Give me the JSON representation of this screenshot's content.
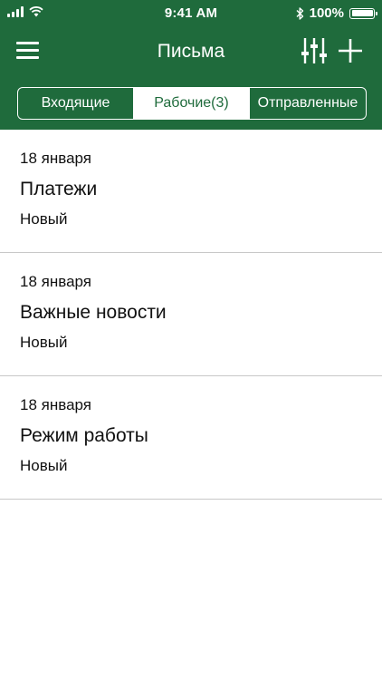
{
  "status_bar": {
    "time": "9:41 AM",
    "battery": "100%",
    "icons": [
      "signal-icon",
      "wifi-icon",
      "bluetooth-icon",
      "battery-icon"
    ]
  },
  "header": {
    "title": "Письма",
    "icons": {
      "menu": "hamburger-menu-icon",
      "filter": "sliders-icon",
      "add": "plus-icon"
    }
  },
  "tabs": [
    {
      "label": "Входящие",
      "active": false
    },
    {
      "label": "Рабочие(3)",
      "active": true
    },
    {
      "label": "Отправленные",
      "active": false
    }
  ],
  "messages": [
    {
      "date": "18 января",
      "title": "Платежи",
      "status": "Новый"
    },
    {
      "date": "18 января",
      "title": "Важные новости",
      "status": "Новый"
    },
    {
      "date": "18 января",
      "title": "Режим работы",
      "status": "Новый"
    }
  ],
  "colors": {
    "header_bg": "#1f6b3c",
    "header_text": "#ffffff",
    "divider": "#c8c8c8",
    "text": "#111111"
  }
}
